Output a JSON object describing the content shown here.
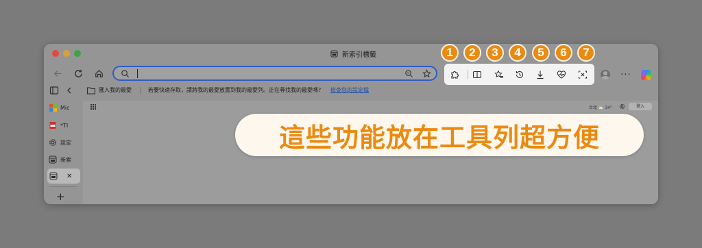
{
  "window": {
    "tab_title": "新索引標籤"
  },
  "toolbar": {
    "back_icon": "back-arrow-icon",
    "refresh_icon": "refresh-icon",
    "home_icon": "home-icon",
    "address_value": "",
    "address_placeholder": ""
  },
  "feature_toolbar": {
    "items": [
      {
        "number": "1",
        "icon": "extensions-icon"
      },
      {
        "number": "2",
        "icon": "split-screen-icon"
      },
      {
        "number": "3",
        "icon": "favorites-icon"
      },
      {
        "number": "4",
        "icon": "history-icon"
      },
      {
        "number": "5",
        "icon": "downloads-icon"
      },
      {
        "number": "6",
        "icon": "browser-essentials-icon"
      },
      {
        "number": "7",
        "icon": "screenshot-icon"
      }
    ],
    "highlight_color": "#f3f3f3",
    "badge_color": "#e98b12"
  },
  "favorites_bar": {
    "import_label": "匯入我的最愛",
    "message": "若要快速存取，請將我的最愛放置到我的最愛列。正在尋找我的最愛嗎?",
    "manage_link": "檢查您的設定檔"
  },
  "sidebar": {
    "items": [
      {
        "label": "Mic"
      },
      {
        "label": "*TI"
      },
      {
        "label": "設定"
      },
      {
        "label": "新索"
      }
    ],
    "active_close": "✕",
    "add": "+"
  },
  "content": {
    "weather": "台北 ⛅ 34°",
    "login": "登入"
  },
  "callout": {
    "text": "這些功能放在工具列超方便",
    "color": "#e98b12"
  }
}
